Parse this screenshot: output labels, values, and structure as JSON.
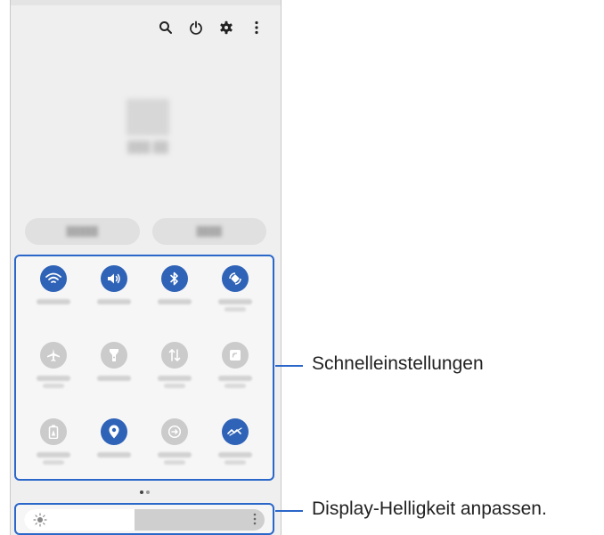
{
  "callouts": {
    "quick_settings": "Schnelleinstellungen",
    "brightness": "Display-Helligkeit anpassen."
  },
  "top_icons": [
    "search-icon",
    "power-icon",
    "settings-gear-icon",
    "more-vertical-icon"
  ],
  "tiles": [
    {
      "name": "wifi",
      "icon": "wifi-icon",
      "state": "on"
    },
    {
      "name": "sound",
      "icon": "sound-icon",
      "state": "on"
    },
    {
      "name": "bluetooth",
      "icon": "bluetooth-icon",
      "state": "on"
    },
    {
      "name": "auto-rotate",
      "icon": "auto-rotate-icon",
      "state": "on"
    },
    {
      "name": "airplane-mode",
      "icon": "airplane-icon",
      "state": "off"
    },
    {
      "name": "flashlight",
      "icon": "flashlight-icon",
      "state": "off"
    },
    {
      "name": "mobile-data",
      "icon": "mobile-data-icon",
      "state": "off"
    },
    {
      "name": "nfc",
      "icon": "nfc-icon",
      "state": "off"
    },
    {
      "name": "power-saving",
      "icon": "battery-icon",
      "state": "off"
    },
    {
      "name": "location",
      "icon": "location-icon",
      "state": "on"
    },
    {
      "name": "data-saver",
      "icon": "data-saver-icon",
      "state": "off"
    },
    {
      "name": "nearby-share",
      "icon": "nearby-share-icon",
      "state": "on"
    }
  ],
  "brightness": {
    "level": 0.46
  },
  "page_indicator": {
    "pages": 2,
    "current": 1
  },
  "colors": {
    "accent": "#2a67c9",
    "tile_on": "#2f63b7",
    "tile_off": "#cbcbcb"
  }
}
